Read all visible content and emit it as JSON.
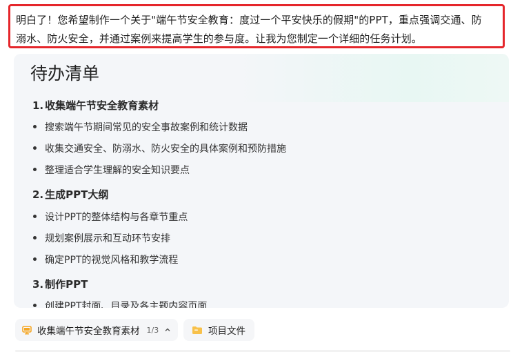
{
  "intro": {
    "line1": "明白了！您希望制作一个关于\"端午节安全教育：度过一个平安快乐的假期\"的PPT，重点强调交通、防",
    "line2": "溺水、防火安全，并通过案例来提高学生的参与度。让我为您制定一个详细的任务计划。"
  },
  "todo": {
    "title": "待办清单",
    "sections": [
      {
        "number": "1.",
        "title": "收集端午节安全教育素材",
        "items": [
          "搜索端午节期间常见的安全事故案例和统计数据",
          "收集交通安全、防溺水、防火安全的具体案例和预防措施",
          "整理适合学生理解的安全知识要点"
        ]
      },
      {
        "number": "2.",
        "title": "生成PPT大纲",
        "items": [
          "设计PPT的整体结构与各章节重点",
          "规划案例展示和互动环节安排",
          "确定PPT的视觉风格和教学流程"
        ]
      },
      {
        "number": "3.",
        "title": "制作PPT",
        "items": [
          "创建PPT封面、目录及各主题内容页面"
        ]
      }
    ]
  },
  "bottom_bar": {
    "task_chip": {
      "label": "收集端午节安全教育素材",
      "counter": "1/3",
      "icon": "monitor-icon",
      "chevron": "chevron-up-icon"
    },
    "files_chip": {
      "label": "项目文件",
      "icon": "folder-icon"
    }
  },
  "colors": {
    "highlight_border": "#e5262b",
    "panel_bg": "#f4f6f9",
    "accent_orange": "#f5a623"
  }
}
